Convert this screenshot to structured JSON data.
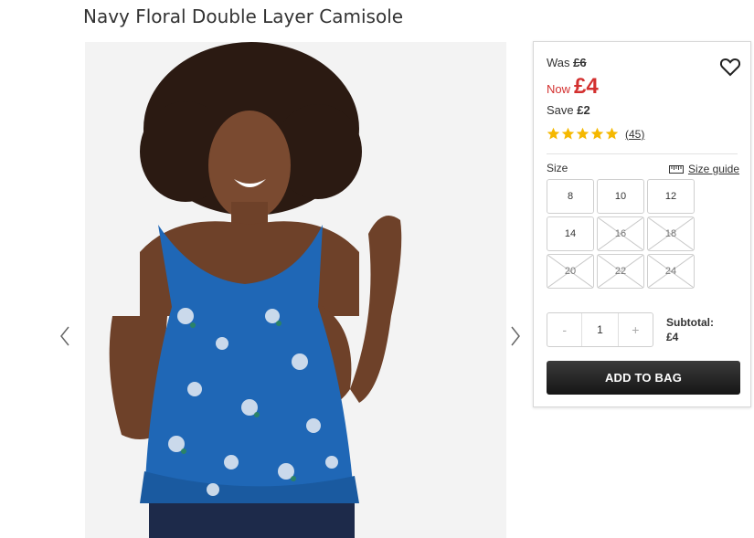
{
  "product": {
    "title": "Navy Floral Double Layer Camisole"
  },
  "gallery": {
    "prev_icon": "chevron-left-icon",
    "next_icon": "chevron-right-icon"
  },
  "pricing": {
    "was_label": "Was",
    "was_price": "£6",
    "now_label": "Now",
    "now_price": "£4",
    "save_label": "Save",
    "save_amount": "£2",
    "accent_color": "#d3302f"
  },
  "rating": {
    "stars": 5,
    "max_stars": 5,
    "reviews": "(45)",
    "star_color": "#f5b800"
  },
  "size": {
    "label": "Size",
    "guide_label": "Size guide",
    "options": [
      {
        "label": "8",
        "available": true
      },
      {
        "label": "10",
        "available": true
      },
      {
        "label": "12",
        "available": true
      },
      {
        "label": "14",
        "available": true
      },
      {
        "label": "16",
        "available": false
      },
      {
        "label": "18",
        "available": false
      },
      {
        "label": "20",
        "available": false
      },
      {
        "label": "22",
        "available": false
      },
      {
        "label": "24",
        "available": false
      }
    ]
  },
  "quantity": {
    "minus": "-",
    "value": "1",
    "plus": "+"
  },
  "subtotal": {
    "label": "Subtotal:",
    "value": "£4"
  },
  "cta": {
    "add_to_bag": "ADD TO BAG"
  }
}
